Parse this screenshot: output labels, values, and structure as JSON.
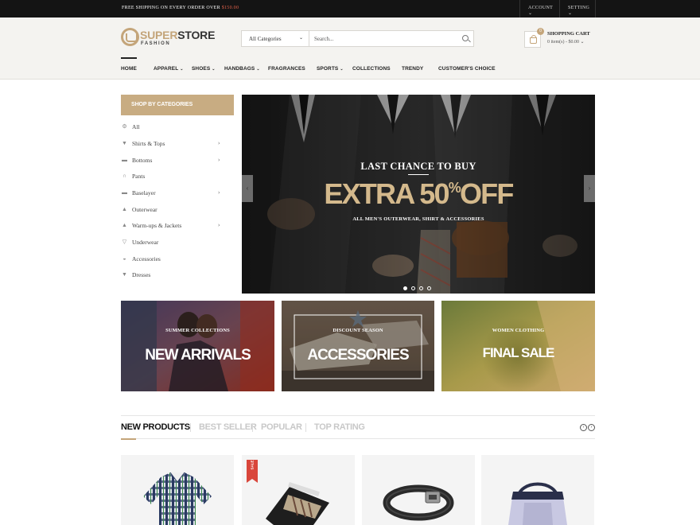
{
  "topbar": {
    "shipping_prefix": "FREE SHIPPING",
    "shipping_middle": "ON EVERY ORDER OVER",
    "shipping_price": "$150.00",
    "account": "ACCOUNT",
    "setting": "SETTING"
  },
  "brand": {
    "part1": "SUPER",
    "part2": "STORE",
    "tagline": "FASHION",
    "accent": "#c4a57a"
  },
  "search": {
    "category": "All Categories",
    "placeholder": "Search..."
  },
  "cart": {
    "title": "SHOPPING CART",
    "summary": "0 item(s) - $0.00",
    "count": "0"
  },
  "nav": {
    "items": [
      {
        "label": "HOME"
      },
      {
        "label": "APPAREL"
      },
      {
        "label": "SHOES"
      },
      {
        "label": "HANDBAGS"
      },
      {
        "label": "FRAGRANCES"
      },
      {
        "label": "SPORTS"
      },
      {
        "label": "COLLECTIONS"
      },
      {
        "label": "TRENDY"
      },
      {
        "label": "CUSTOMER'S CHOICE"
      }
    ]
  },
  "sidebar": {
    "heading": "SHOP BY CATEGORIES",
    "items": [
      {
        "label": "All",
        "icon": "gear-icon"
      },
      {
        "label": "Shirts & Tops",
        "icon": "shirt-icon"
      },
      {
        "label": "Bottoms",
        "icon": "shorts-icon"
      },
      {
        "label": "Pants",
        "icon": "pants-icon"
      },
      {
        "label": "Baselayer",
        "icon": "baselayer-icon"
      },
      {
        "label": "Outerwear",
        "icon": "jacket-icon"
      },
      {
        "label": "Warm-ups & Jackets",
        "icon": "hoodie-icon"
      },
      {
        "label": "Underwear",
        "icon": "underwear-icon"
      },
      {
        "label": "Accessories",
        "icon": "cap-icon"
      },
      {
        "label": "Dresses",
        "icon": "dress-icon"
      }
    ]
  },
  "slider": {
    "headline": "LAST CHANCE TO BUY",
    "offer_a": "EXTRA 50",
    "offer_pct": "%",
    "offer_b": "OFF",
    "subline": "ALL MEN'S OUTERWEAR, SHIRT & ACCESSORIES",
    "prev": "‹",
    "next": "›"
  },
  "banners": [
    {
      "sub": "SUMMER COLLECTIONS",
      "title": "NEW ARRIVALS"
    },
    {
      "sub": "DISCOUNT SEASON",
      "title": "ACCESSORIES"
    },
    {
      "sub": "WOMEN CLOTHING",
      "title": "FINAL SALE"
    }
  ],
  "tabs": {
    "items": [
      "NEW PRODUCTS",
      "BEST SELLER",
      "POPULAR",
      "TOP RATING"
    ],
    "prev": "‹",
    "next": "›"
  },
  "products": {
    "sale_badge": "SALE"
  }
}
